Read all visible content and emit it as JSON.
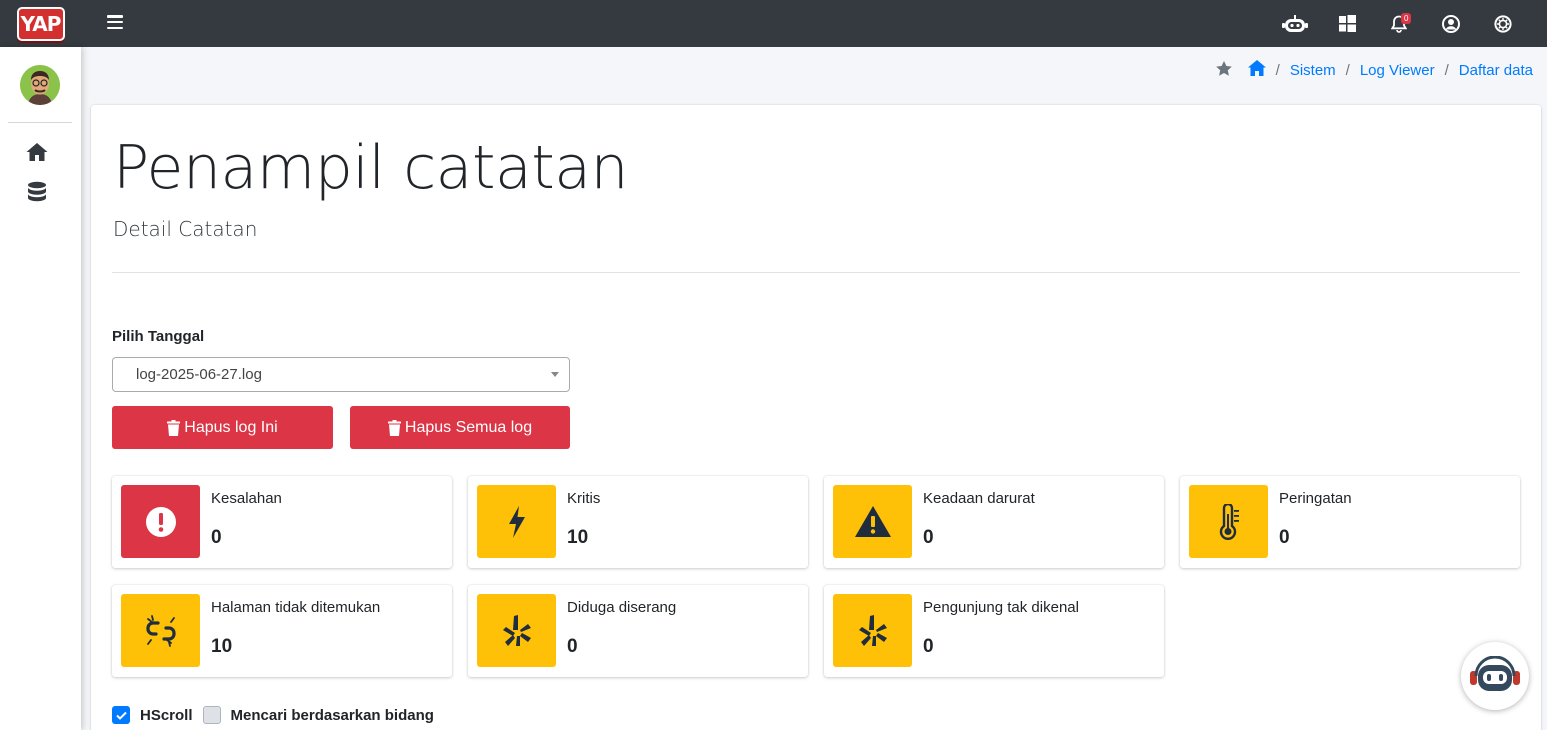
{
  "brand": {
    "logo_text": "YAP"
  },
  "navbar": {
    "notification_count": "0",
    "icons": [
      "menu-icon",
      "robot-icon",
      "windows-icon",
      "bell-icon",
      "user-circle-icon",
      "settings-icon"
    ]
  },
  "sidebar": {
    "icons": [
      "home-icon",
      "database-icon"
    ]
  },
  "breadcrumb": {
    "items": [
      "Sistem",
      "Log Viewer",
      "Daftar data"
    ],
    "separator": "/"
  },
  "page": {
    "title": "Penampil catatan",
    "subtitle": "Detail Catatan"
  },
  "form": {
    "date_label": "Pilih Tanggal",
    "selected_log": "log-2025-06-27.log",
    "delete_one_label": "Hapus log Ini",
    "delete_all_label": "Hapus Semua log"
  },
  "stats": [
    {
      "label": "Kesalahan",
      "value": "0",
      "color": "#dc3545",
      "icon": "exclamation-circle-icon"
    },
    {
      "label": "Kritis",
      "value": "10",
      "color": "#ffc107",
      "icon": "bolt-icon"
    },
    {
      "label": "Keadaan darurat",
      "value": "0",
      "color": "#ffc107",
      "icon": "warning-triangle-icon"
    },
    {
      "label": "Peringatan",
      "value": "0",
      "color": "#ffc107",
      "icon": "thermometer-icon"
    },
    {
      "label": "Halaman tidak ditemukan",
      "value": "10",
      "color": "#ffc107",
      "icon": "broken-link-icon"
    },
    {
      "label": "Diduga diserang",
      "value": "0",
      "color": "#ffc107",
      "icon": "yelp-icon"
    },
    {
      "label": "Pengunjung tak dikenal",
      "value": "0",
      "color": "#ffc107",
      "icon": "yelp-icon"
    }
  ],
  "options": {
    "hscroll_label": "HScroll",
    "hscroll_checked": true,
    "field_search_label": "Mencari berdasarkan bidang",
    "field_search_checked": false
  },
  "colors": {
    "navbar": "#343a40",
    "link": "#007bff",
    "danger": "#dc3545",
    "warning": "#ffc107"
  }
}
